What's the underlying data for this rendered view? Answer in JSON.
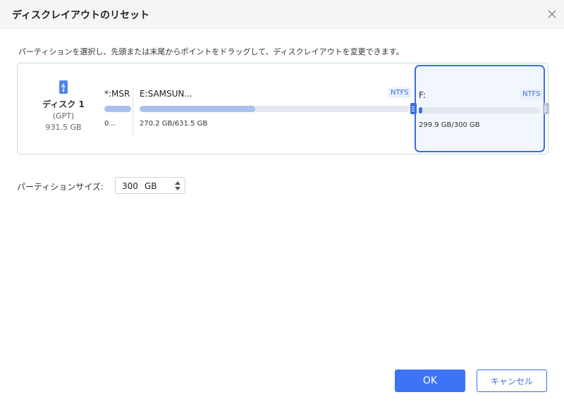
{
  "dialog": {
    "title": "ディスクレイアウトのリセット",
    "instruction": "パーティションを選択し、先頭または末尾からポイントをドラッグして、ディスクレイアウトを変更できます。"
  },
  "disk": {
    "icon": "usb-drive-icon",
    "name": "ディスク 1",
    "type": "(GPT)",
    "size": "931.5 GB"
  },
  "partitions": [
    {
      "label": "*:MSR",
      "size": "0...",
      "filesystem": "",
      "used_fraction": 1.0,
      "selected": false
    },
    {
      "label": "E:SAMSUN...",
      "size": "270.2 GB/631.5 GB",
      "filesystem": "NTFS",
      "used_fraction": 0.428,
      "selected": false
    },
    {
      "label": "F:",
      "size": "299.9 GB/300 GB",
      "filesystem": "NTFS",
      "used_fraction": 0.02,
      "selected": true
    }
  ],
  "partition_size": {
    "label": "パーティションサイズ:",
    "value": "300",
    "unit": "GB"
  },
  "buttons": {
    "ok": "OK",
    "cancel": "キャンセル"
  },
  "colors": {
    "accent": "#3b74f6",
    "selection_border": "#3b6fe0",
    "bar_fill": "#a9c1ea",
    "bar_track": "#e3e7f1"
  }
}
